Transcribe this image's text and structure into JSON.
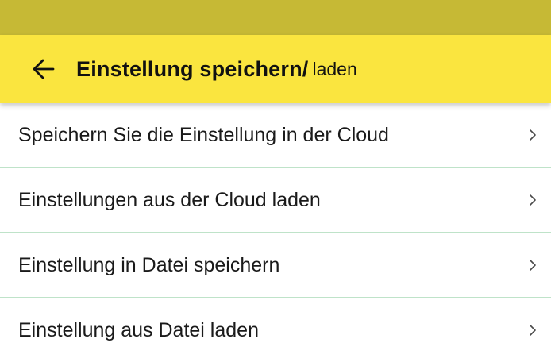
{
  "colors": {
    "status_bar": "#c6b935",
    "app_bar": "#fae53f",
    "divider": "#bfe3c9",
    "text": "#1a1a1a"
  },
  "header": {
    "back_icon": "arrow-left-icon",
    "title_main": "Einstellung speichern/",
    "title_suffix": "laden"
  },
  "menu": {
    "items": [
      {
        "label": "Speichern Sie die Einstellung in der Cloud",
        "icon": "chevron-right-icon"
      },
      {
        "label": "Einstellungen aus der Cloud laden",
        "icon": "chevron-right-icon"
      },
      {
        "label": "Einstellung in Datei speichern",
        "icon": "chevron-right-icon"
      },
      {
        "label": "Einstellung aus Datei laden",
        "icon": "chevron-right-icon"
      }
    ]
  }
}
